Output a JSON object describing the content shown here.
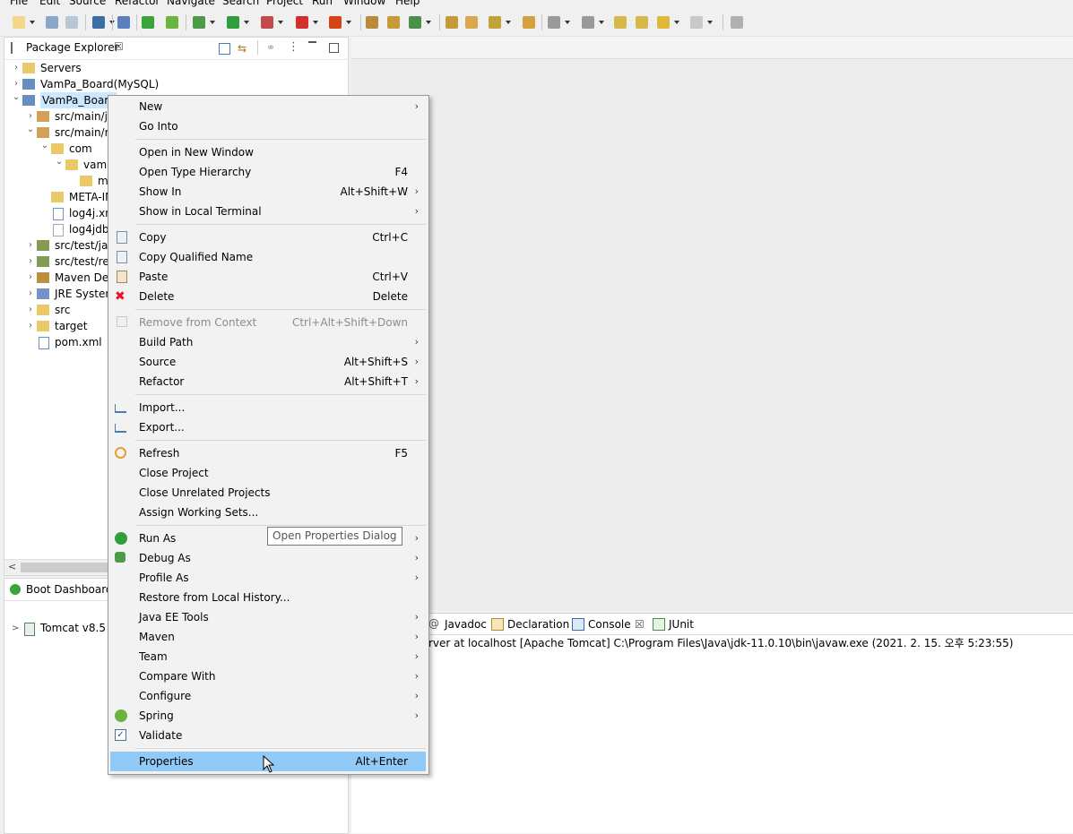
{
  "menubar": [
    "File",
    "Edit",
    "Source",
    "Refactor",
    "Navigate",
    "Search",
    "Project",
    "Run",
    "Window",
    "Help"
  ],
  "package_explorer": {
    "title": "Package Explorer",
    "tree": [
      {
        "label": "Servers",
        "expanded": false
      },
      {
        "label": "VamPa_Board(MySQL)",
        "expanded": false
      },
      {
        "label": "VamPa_Board",
        "expanded": true
      },
      {
        "label": "src/main/ja",
        "expanded": false
      },
      {
        "label": "src/main/re",
        "expanded": true
      },
      {
        "label": "com",
        "expanded": true
      },
      {
        "label": "vam",
        "expanded": true
      },
      {
        "label": "m",
        "expanded": false
      },
      {
        "label": "META-IN",
        "expanded": false
      },
      {
        "label": "log4j.xm",
        "expanded": false
      },
      {
        "label": "log4jdb",
        "expanded": false
      },
      {
        "label": "src/test/jav",
        "expanded": false
      },
      {
        "label": "src/test/res",
        "expanded": false
      },
      {
        "label": "Maven Dep",
        "expanded": false
      },
      {
        "label": "JRE System",
        "expanded": false
      },
      {
        "label": "src",
        "expanded": false
      },
      {
        "label": "target",
        "expanded": false
      },
      {
        "label": "pom.xml",
        "expanded": false
      }
    ]
  },
  "boot_dashboard": {
    "title": "Boot Dashboard",
    "server_item": "Tomcat v8.5 S"
  },
  "bottom_tabs": [
    "Javadoc",
    "Declaration",
    "Console",
    "JUnit"
  ],
  "console": {
    "line": "rver at localhost [Apache Tomcat] C:\\Program Files\\Java\\jdk-11.0.10\\bin\\javaw.exe  (2021. 2. 15. 오후 5:23:55)"
  },
  "context_menu": {
    "groups": [
      [
        {
          "label": "New",
          "accel": "",
          "submenu": true
        },
        {
          "label": "Go Into",
          "accel": "",
          "submenu": false
        }
      ],
      [
        {
          "label": "Open in New Window",
          "accel": "",
          "submenu": false
        },
        {
          "label": "Open Type Hierarchy",
          "accel": "F4",
          "submenu": false
        },
        {
          "label": "Show In",
          "accel": "Alt+Shift+W",
          "submenu": true
        },
        {
          "label": "Show in Local Terminal",
          "accel": "",
          "submenu": true
        }
      ],
      [
        {
          "label": "Copy",
          "accel": "Ctrl+C",
          "submenu": false,
          "icon": "copy-icon"
        },
        {
          "label": "Copy Qualified Name",
          "accel": "",
          "submenu": false,
          "icon": "copy-qualified-icon"
        },
        {
          "label": "Paste",
          "accel": "Ctrl+V",
          "submenu": false,
          "icon": "paste-icon"
        },
        {
          "label": "Delete",
          "accel": "Delete",
          "submenu": false,
          "icon": "delete-icon"
        }
      ],
      [
        {
          "label": "Remove from Context",
          "accel": "Ctrl+Alt+Shift+Down",
          "submenu": false,
          "disabled": true,
          "icon": "remove-context-icon"
        },
        {
          "label": "Build Path",
          "accel": "",
          "submenu": true
        },
        {
          "label": "Source",
          "accel": "Alt+Shift+S",
          "submenu": true
        },
        {
          "label": "Refactor",
          "accel": "Alt+Shift+T",
          "submenu": true
        }
      ],
      [
        {
          "label": "Import...",
          "accel": "",
          "submenu": false,
          "icon": "import-icon"
        },
        {
          "label": "Export...",
          "accel": "",
          "submenu": false,
          "icon": "export-icon"
        }
      ],
      [
        {
          "label": "Refresh",
          "accel": "F5",
          "submenu": false,
          "icon": "refresh-icon"
        },
        {
          "label": "Close Project",
          "accel": "",
          "submenu": false
        },
        {
          "label": "Close Unrelated Projects",
          "accel": "",
          "submenu": false
        },
        {
          "label": "Assign Working Sets...",
          "accel": "",
          "submenu": false
        }
      ],
      [
        {
          "label": "Run As",
          "accel": "",
          "submenu": true,
          "icon": "run-icon"
        },
        {
          "label": "Debug As",
          "accel": "",
          "submenu": true,
          "icon": "debug-icon"
        },
        {
          "label": "Profile As",
          "accel": "",
          "submenu": true
        },
        {
          "label": "Restore from Local History...",
          "accel": "",
          "submenu": false
        },
        {
          "label": "Java EE Tools",
          "accel": "",
          "submenu": true
        },
        {
          "label": "Maven",
          "accel": "",
          "submenu": true
        },
        {
          "label": "Team",
          "accel": "",
          "submenu": true
        },
        {
          "label": "Compare With",
          "accel": "",
          "submenu": true
        },
        {
          "label": "Configure",
          "accel": "",
          "submenu": true
        },
        {
          "label": "Spring",
          "accel": "",
          "submenu": true,
          "icon": "spring-icon"
        },
        {
          "label": "Validate",
          "accel": "",
          "submenu": false,
          "icon": "validate-icon"
        }
      ],
      [
        {
          "label": "Properties",
          "accel": "Alt+Enter",
          "submenu": false,
          "selected": true
        }
      ]
    ],
    "submenu_glyph": "›"
  },
  "tooltip": "Open Properties Dialog",
  "colors": {
    "selection": "#91c9f7",
    "tree_selection": "#cce8ff",
    "delete_red": "#e81123",
    "run_green": "#2e9e3e",
    "spring_green": "#6db33f",
    "folder_yellow": "#e8c04f"
  }
}
